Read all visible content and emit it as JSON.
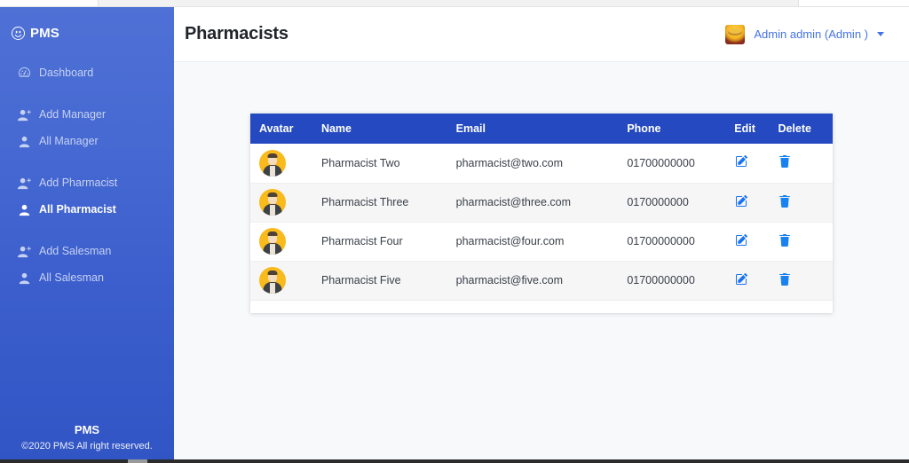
{
  "brand": {
    "label": "PMS",
    "icon": "emoji-smile-icon"
  },
  "sidebar": {
    "groups": [
      {
        "items": [
          {
            "label": "Dashboard",
            "icon": "speedometer-icon",
            "active": false
          }
        ]
      },
      {
        "items": [
          {
            "label": "Add Manager",
            "icon": "person-plus-icon",
            "active": false
          },
          {
            "label": "All Manager",
            "icon": "person-icon",
            "active": false
          }
        ]
      },
      {
        "items": [
          {
            "label": "Add Pharmacist",
            "icon": "person-plus-icon",
            "active": false
          },
          {
            "label": "All Pharmacist",
            "icon": "person-icon",
            "active": true
          }
        ]
      },
      {
        "items": [
          {
            "label": "Add Salesman",
            "icon": "person-plus-icon",
            "active": false
          },
          {
            "label": "All Salesman",
            "icon": "person-icon",
            "active": false
          }
        ]
      }
    ],
    "footer": {
      "title": "PMS",
      "copyright": "©2020 PMS All right reserved."
    }
  },
  "topbar": {
    "page_title": "Pharmacists",
    "user": {
      "name": "Admin admin (Admin )",
      "avatar_icon": "user-avatar",
      "caret_icon": "chevron-down-icon"
    }
  },
  "table": {
    "columns": [
      "Avatar",
      "Name",
      "Email",
      "Phone",
      "Edit",
      "Delete"
    ],
    "rows": [
      {
        "avatar": "default-user-avatar",
        "name": "Pharmacist Two",
        "email": "pharmacist@two.com",
        "phone": "01700000000",
        "edit_icon": "pencil-square-icon",
        "delete_icon": "trash-icon"
      },
      {
        "avatar": "default-user-avatar",
        "name": "Pharmacist Three",
        "email": "pharmacist@three.com",
        "phone": "0170000000",
        "edit_icon": "pencil-square-icon",
        "delete_icon": "trash-icon"
      },
      {
        "avatar": "default-user-avatar",
        "name": "Pharmacist Four",
        "email": "pharmacist@four.com",
        "phone": "01700000000",
        "edit_icon": "pencil-square-icon",
        "delete_icon": "trash-icon"
      },
      {
        "avatar": "default-user-avatar",
        "name": "Pharmacist Five",
        "email": "pharmacist@five.com",
        "phone": "01700000000",
        "edit_icon": "pencil-square-icon",
        "delete_icon": "trash-icon"
      }
    ]
  },
  "colors": {
    "sidebar_top": "#4f71d6",
    "sidebar_bottom": "#3155c4",
    "table_header": "#2449c0",
    "link": "#4472e8",
    "action_icon": "#1a7af0",
    "content_bg": "#f8f9fa",
    "row_alt_bg": "#f6f6f7"
  }
}
